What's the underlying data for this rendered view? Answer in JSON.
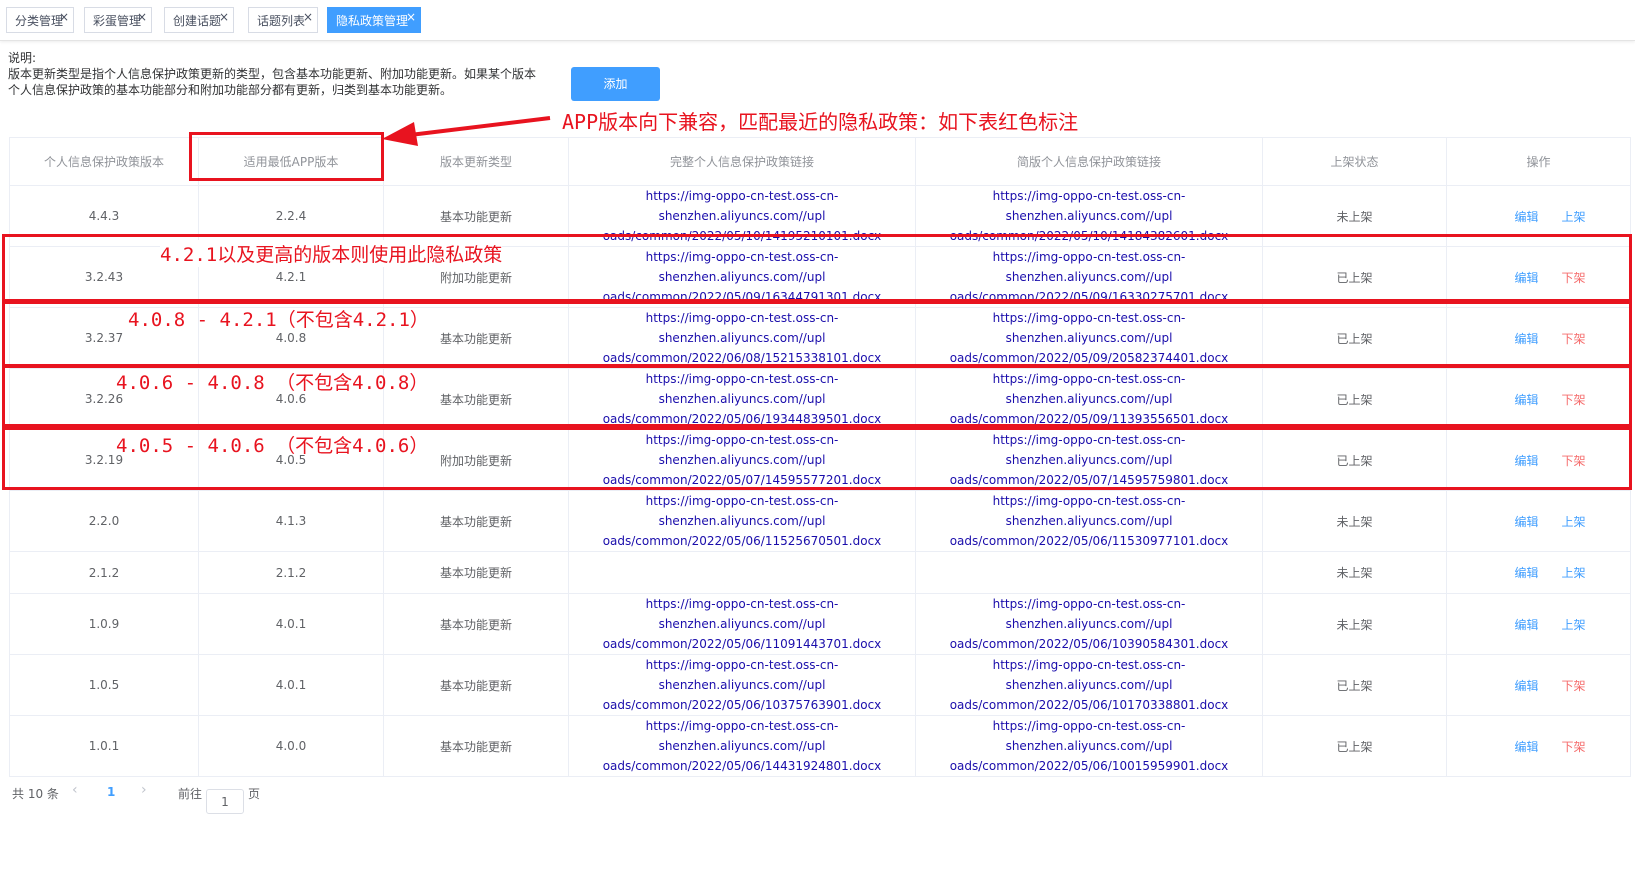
{
  "tabs": [
    {
      "label": "分类管理",
      "close": "×"
    },
    {
      "label": "彩蛋管理",
      "close": "×"
    },
    {
      "label": "创建话题",
      "close": "×"
    },
    {
      "label": "话题列表",
      "close": "×"
    },
    {
      "label": "隐私政策管理",
      "close": "×"
    }
  ],
  "description": {
    "title": "说明:",
    "line1": "版本更新类型是指个人信息保护政策更新的类型，包含基本功能更新、附加功能更新。如果某个版本",
    "line2": "个人信息保护政策的基本功能部分和附加功能部分都有更新，归类到基本功能更新。"
  },
  "add_button": "添加",
  "columns": [
    "个人信息保护政策版本",
    "适用最低APP版本",
    "版本更新类型",
    "完整个人信息保护政策链接",
    "简版个人信息保护政策链接",
    "上架状态",
    "操作"
  ],
  "rows": [
    {
      "version": "4.4.3",
      "min_app": "2.2.4",
      "type": "基本功能更新",
      "full1": "https://img-oppo-cn-test.oss-cn-shenzhen.aliyuncs.com//upl",
      "full2": "oads/common/2022/05/10/14195210101.docx",
      "short1": "https://img-oppo-cn-test.oss-cn-shenzhen.aliyuncs.com//upl",
      "short2": "oads/common/2022/05/10/14184382601.docx",
      "status": "未上架",
      "edit": "编辑",
      "action": "上架"
    },
    {
      "version": "3.2.43",
      "min_app": "4.2.1",
      "type": "附加功能更新",
      "full1": "https://img-oppo-cn-test.oss-cn-shenzhen.aliyuncs.com//upl",
      "full2": "oads/common/2022/05/09/16344791301.docx",
      "short1": "https://img-oppo-cn-test.oss-cn-shenzhen.aliyuncs.com//upl",
      "short2": "oads/common/2022/05/09/16330275701.docx",
      "status": "已上架",
      "edit": "编辑",
      "action": "下架"
    },
    {
      "version": "3.2.37",
      "min_app": "4.0.8",
      "type": "基本功能更新",
      "full1": "https://img-oppo-cn-test.oss-cn-shenzhen.aliyuncs.com//upl",
      "full2": "oads/common/2022/06/08/15215338101.docx",
      "short1": "https://img-oppo-cn-test.oss-cn-shenzhen.aliyuncs.com//upl",
      "short2": "oads/common/2022/05/09/20582374401.docx",
      "status": "已上架",
      "edit": "编辑",
      "action": "下架"
    },
    {
      "version": "3.2.26",
      "min_app": "4.0.6",
      "type": "基本功能更新",
      "full1": "https://img-oppo-cn-test.oss-cn-shenzhen.aliyuncs.com//upl",
      "full2": "oads/common/2022/05/06/19344839501.docx",
      "short1": "https://img-oppo-cn-test.oss-cn-shenzhen.aliyuncs.com//upl",
      "short2": "oads/common/2022/05/09/11393556501.docx",
      "status": "已上架",
      "edit": "编辑",
      "action": "下架"
    },
    {
      "version": "3.2.19",
      "min_app": "4.0.5",
      "type": "附加功能更新",
      "full1": "https://img-oppo-cn-test.oss-cn-shenzhen.aliyuncs.com//upl",
      "full2": "oads/common/2022/05/07/14595577201.docx",
      "short1": "https://img-oppo-cn-test.oss-cn-shenzhen.aliyuncs.com//upl",
      "short2": "oads/common/2022/05/07/14595759801.docx",
      "status": "已上架",
      "edit": "编辑",
      "action": "下架"
    },
    {
      "version": "2.2.0",
      "min_app": "4.1.3",
      "type": "基本功能更新",
      "full1": "https://img-oppo-cn-test.oss-cn-shenzhen.aliyuncs.com//upl",
      "full2": "oads/common/2022/05/06/11525670501.docx",
      "short1": "https://img-oppo-cn-test.oss-cn-shenzhen.aliyuncs.com//upl",
      "short2": "oads/common/2022/05/06/11530977101.docx",
      "status": "未上架",
      "edit": "编辑",
      "action": "上架"
    },
    {
      "version": "2.1.2",
      "min_app": "2.1.2",
      "type": "基本功能更新",
      "full1": "",
      "full2": "",
      "short1": "",
      "short2": "",
      "status": "未上架",
      "edit": "编辑",
      "action": "上架"
    },
    {
      "version": "1.0.9",
      "min_app": "4.0.1",
      "type": "基本功能更新",
      "full1": "https://img-oppo-cn-test.oss-cn-shenzhen.aliyuncs.com//upl",
      "full2": "oads/common/2022/05/06/11091443701.docx",
      "short1": "https://img-oppo-cn-test.oss-cn-shenzhen.aliyuncs.com//upl",
      "short2": "oads/common/2022/05/06/10390584301.docx",
      "status": "未上架",
      "edit": "编辑",
      "action": "上架"
    },
    {
      "version": "1.0.5",
      "min_app": "4.0.1",
      "type": "基本功能更新",
      "full1": "https://img-oppo-cn-test.oss-cn-shenzhen.aliyuncs.com//upl",
      "full2": "oads/common/2022/05/06/10375763901.docx",
      "short1": "https://img-oppo-cn-test.oss-cn-shenzhen.aliyuncs.com//upl",
      "short2": "oads/common/2022/05/06/10170338801.docx",
      "status": "已上架",
      "edit": "编辑",
      "action": "下架"
    },
    {
      "version": "1.0.1",
      "min_app": "4.0.0",
      "type": "基本功能更新",
      "full1": "https://img-oppo-cn-test.oss-cn-shenzhen.aliyuncs.com//upl",
      "full2": "oads/common/2022/05/06/14431924801.docx",
      "short1": "https://img-oppo-cn-test.oss-cn-shenzhen.aliyuncs.com//upl",
      "short2": "oads/common/2022/05/06/10015959901.docx",
      "status": "已上架",
      "edit": "编辑",
      "action": "下架"
    }
  ],
  "pagination": {
    "total": "共 10 条",
    "prev": "‹",
    "page": "1",
    "next": "›",
    "goto": "前往",
    "goto_value": "1",
    "unit": "页"
  },
  "annotations": {
    "arrow_note": "APP版本向下兼容，匹配最近的隐私政策：如下表红色标注",
    "box1": "4.2.1以及更高的版本则使用此隐私政策",
    "box2": "4.0.8 - 4.2.1（不包含4.2.1）",
    "box3": "4.0.6 - 4.0.8 （不包含4.0.8）",
    "box4": "4.0.5 - 4.0.6 （不包含4.0.6）",
    "color": "#e8131f"
  }
}
